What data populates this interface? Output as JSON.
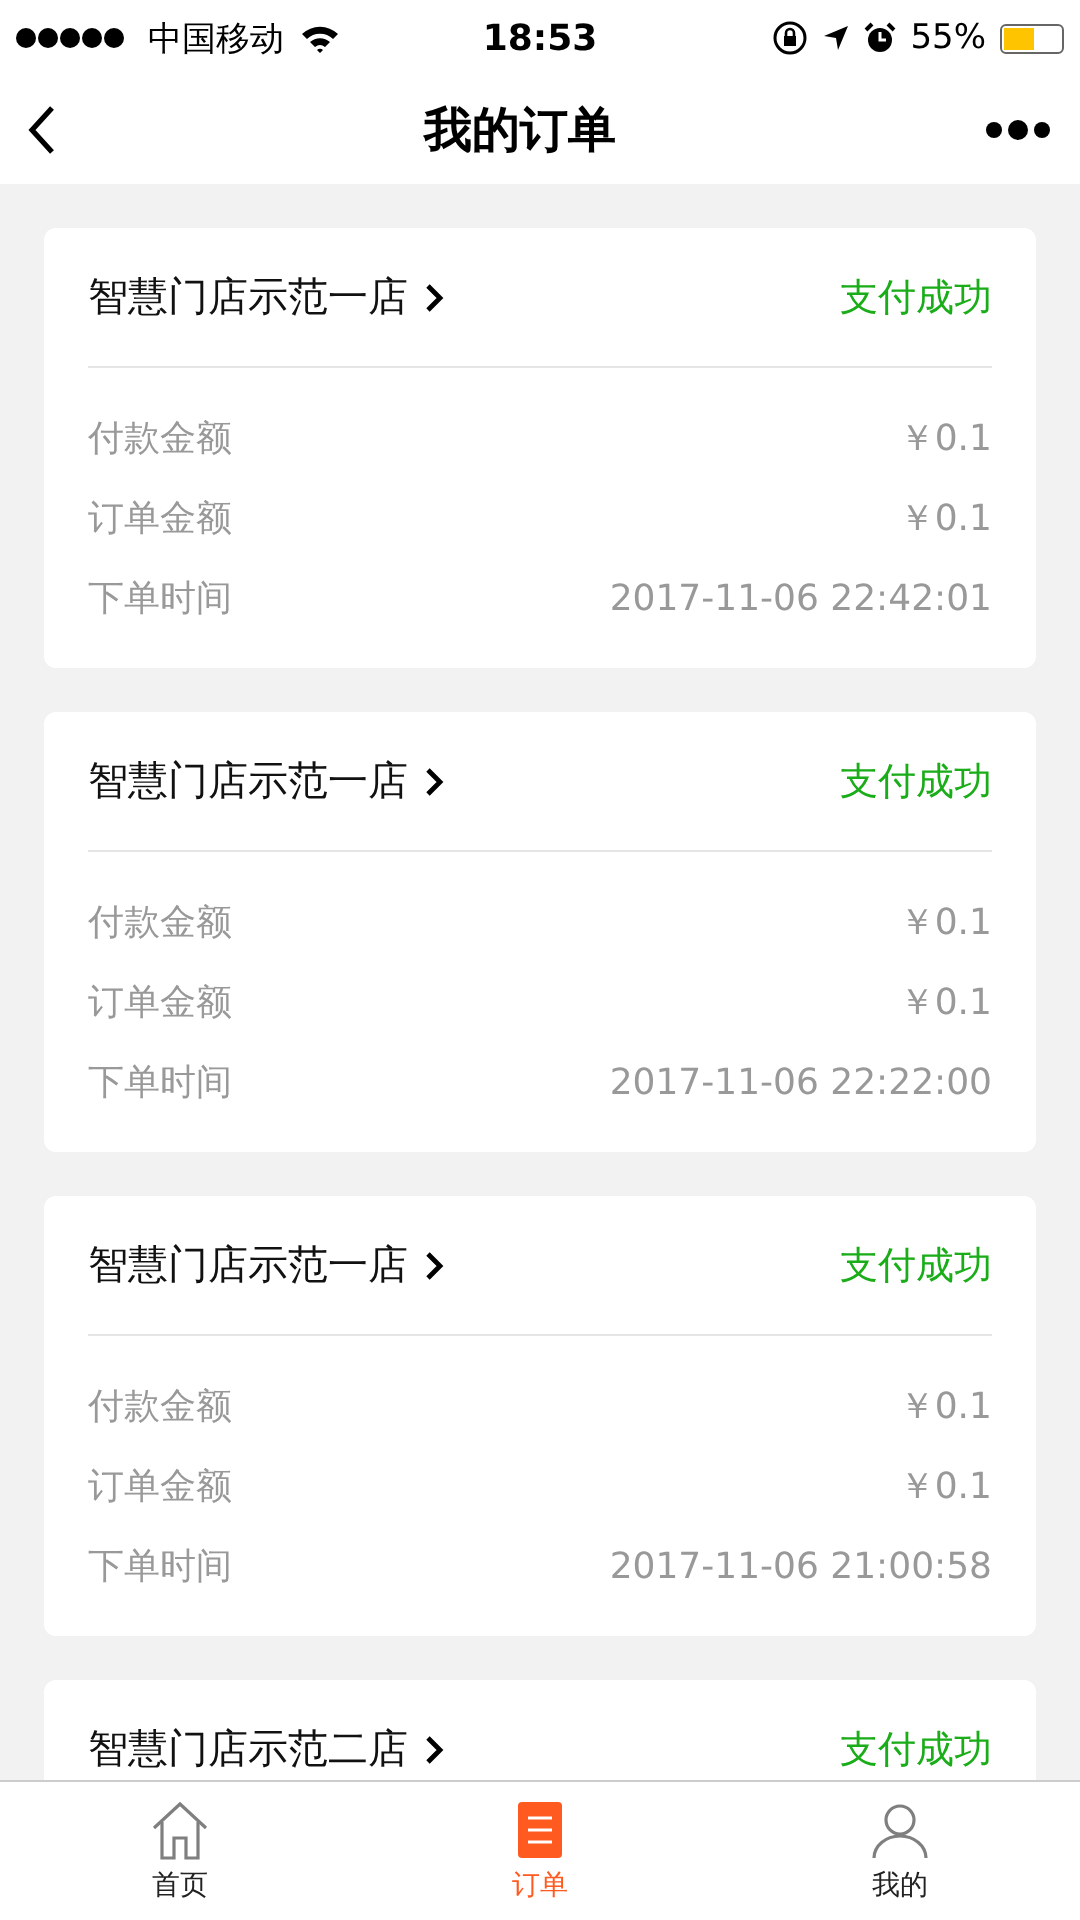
{
  "status_bar": {
    "carrier": "中国移动",
    "time": "18:53",
    "battery_text": "55%",
    "battery": {
      "level": 0.55
    }
  },
  "nav": {
    "title": "我的订单"
  },
  "orders": [
    {
      "store": "智慧门店示范一店",
      "status": "支付成功",
      "fields": [
        {
          "label": "付款金额",
          "value": "￥0.1"
        },
        {
          "label": "订单金额",
          "value": "￥0.1"
        },
        {
          "label": "下单时间",
          "value": "2017-11-06 22:42:01"
        }
      ]
    },
    {
      "store": "智慧门店示范一店",
      "status": "支付成功",
      "fields": [
        {
          "label": "付款金额",
          "value": "￥0.1"
        },
        {
          "label": "订单金额",
          "value": "￥0.1"
        },
        {
          "label": "下单时间",
          "value": "2017-11-06 22:22:00"
        }
      ]
    },
    {
      "store": "智慧门店示范一店",
      "status": "支付成功",
      "fields": [
        {
          "label": "付款金额",
          "value": "￥0.1"
        },
        {
          "label": "订单金额",
          "value": "￥0.1"
        },
        {
          "label": "下单时间",
          "value": "2017-11-06 21:00:58"
        }
      ]
    },
    {
      "store": "智慧门店示范二店",
      "status": "支付成功"
    }
  ],
  "tab_bar": [
    {
      "kind": "home",
      "label": "首页",
      "selected": false
    },
    {
      "kind": "orders",
      "label": "订单",
      "selected": true
    },
    {
      "kind": "profile",
      "label": "我的",
      "selected": false
    }
  ]
}
